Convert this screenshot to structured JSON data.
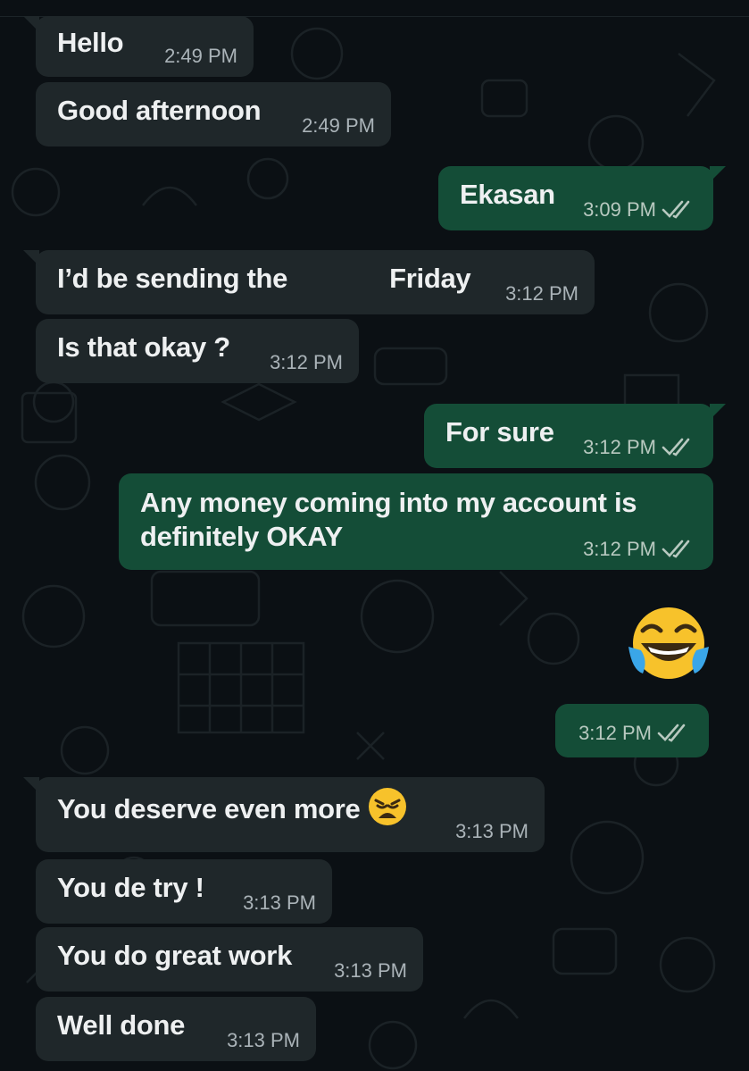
{
  "messages": [
    {
      "id": "m1",
      "direction": "incoming",
      "text": "Hello",
      "time": "2:49 PM"
    },
    {
      "id": "m2",
      "direction": "incoming",
      "text": "Good afternoon",
      "time": "2:49 PM"
    },
    {
      "id": "m3",
      "direction": "outgoing",
      "text": "Ekasan",
      "time": "3:09 PM",
      "status": "read"
    },
    {
      "id": "m4",
      "direction": "incoming",
      "text_before": "I’d be sending the",
      "text_after": "Friday",
      "redacted": true,
      "time": "3:12 PM"
    },
    {
      "id": "m5",
      "direction": "incoming",
      "text": "Is that okay ?",
      "time": "3:12 PM"
    },
    {
      "id": "m6",
      "direction": "outgoing",
      "text": "For sure",
      "time": "3:12 PM",
      "status": "read"
    },
    {
      "id": "m7",
      "direction": "outgoing",
      "line1": "Any money coming into my account is",
      "line2": "definitely OKAY",
      "time": "3:12 PM",
      "status": "read"
    },
    {
      "id": "m8",
      "direction": "outgoing",
      "emoji": "face-with-tears-of-joy",
      "time": "3:12 PM",
      "status": "read"
    },
    {
      "id": "m9",
      "direction": "incoming",
      "text": "You deserve even more",
      "emoji": "weary-face",
      "time": "3:13 PM"
    },
    {
      "id": "m10",
      "direction": "incoming",
      "text": "You de try !",
      "time": "3:13 PM"
    },
    {
      "id": "m11",
      "direction": "incoming",
      "text": "You do great work",
      "time": "3:13 PM"
    },
    {
      "id": "m12",
      "direction": "incoming",
      "text": "Well done",
      "time": "3:13 PM"
    }
  ],
  "colors": {
    "background": "#0b1014",
    "incoming_bubble": "#1f272a",
    "outgoing_bubble": "#144d37",
    "meta_text": "#aab3b8"
  }
}
